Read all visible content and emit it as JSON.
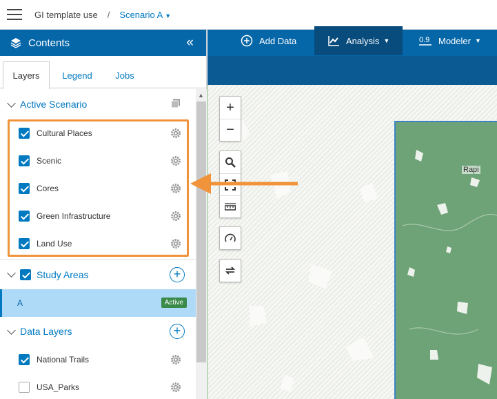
{
  "header": {
    "breadcrumb": "GI template use",
    "separator": "/",
    "scenario": "Scenario A"
  },
  "sidebar": {
    "title": "Contents",
    "collapse_glyph": "«",
    "tabs": [
      {
        "label": "Layers"
      },
      {
        "label": "Legend"
      },
      {
        "label": "Jobs"
      }
    ],
    "active_scenario": {
      "title": "Active Scenario",
      "layers": [
        {
          "label": "Cultural Places",
          "checked": true
        },
        {
          "label": "Scenic",
          "checked": true
        },
        {
          "label": "Cores",
          "checked": true
        },
        {
          "label": "Green Infrastructure",
          "checked": true
        },
        {
          "label": "Land Use",
          "checked": true
        }
      ]
    },
    "study_areas": {
      "title": "Study Areas",
      "checked": true,
      "items": [
        {
          "label": "A",
          "badge": "Active"
        }
      ]
    },
    "data_layers": {
      "title": "Data Layers",
      "layers": [
        {
          "label": "National Trails",
          "checked": true
        },
        {
          "label": "USA_Parks",
          "checked": false
        }
      ]
    }
  },
  "toolbar": {
    "add_data": "Add Data",
    "analysis": "Analysis",
    "modeler": "Modeler"
  },
  "map": {
    "town_label": "Rapi",
    "zoom_in": "+",
    "zoom_out": "−"
  },
  "colors": {
    "brand_blue": "#0566a8",
    "highlight_orange": "#f0933a",
    "active_badge": "#3a8a4a"
  }
}
